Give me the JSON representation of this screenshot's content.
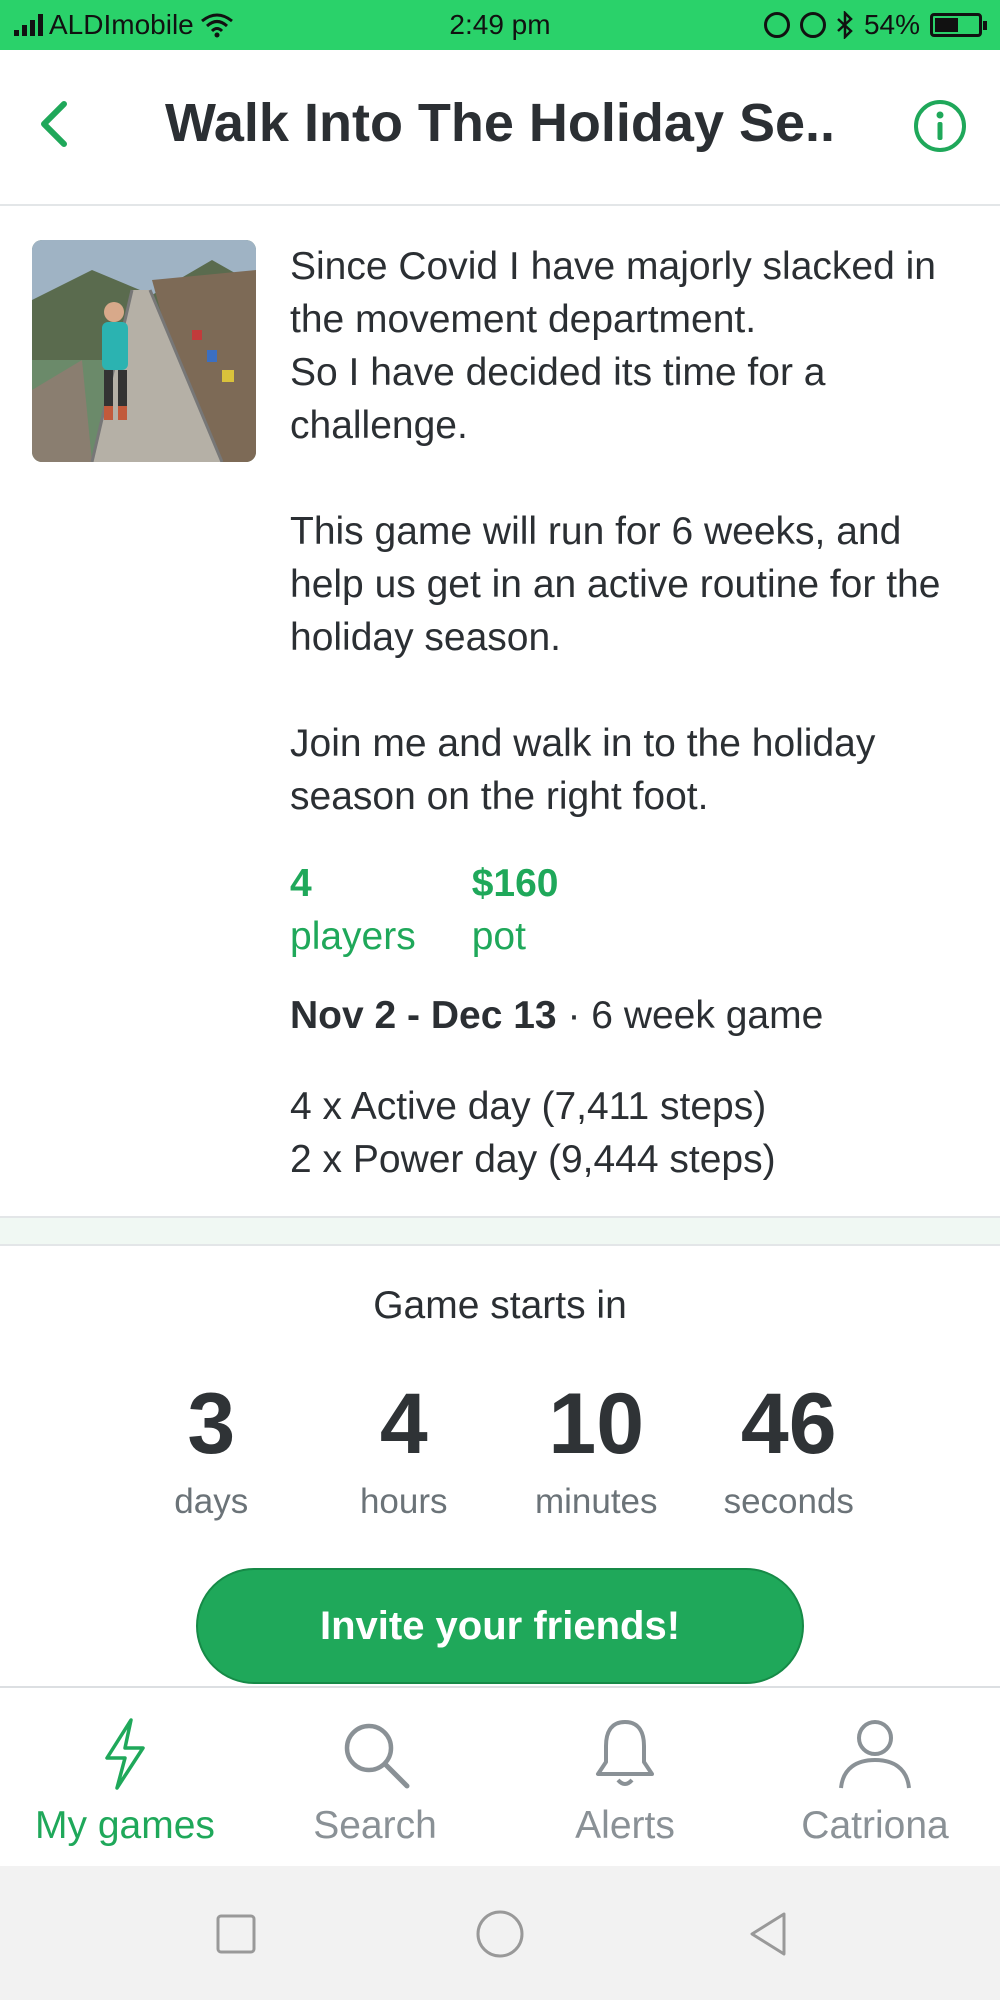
{
  "status_bar": {
    "carrier": "ALDImobile",
    "time": "2:49 pm",
    "battery": "54%",
    "battery_level": 0.54
  },
  "header": {
    "title": "Walk Into The Holiday Se..",
    "back_icon": "chevron-left-icon",
    "info_icon": "info-icon"
  },
  "description": {
    "paragraphs": [
      "Since Covid I have majorly slacked in the movement department.\nSo I have decided its time for a challenge.",
      "This game will run for 6 weeks, and help us get in an active routine for the holiday season.",
      "Join me and walk in to the holiday season on the right foot."
    ]
  },
  "stats": {
    "players_count": "4",
    "players_label": "players",
    "pot_value": "$160",
    "pot_label": "pot"
  },
  "schedule": {
    "dates": "Nov 2 - Dec 13",
    "duration": "· 6 week game"
  },
  "goals": [
    "4 x Active day (7,411 steps)",
    "2 x Power day (9,444 steps)"
  ],
  "countdown": {
    "title": "Game starts in",
    "units": [
      {
        "value": "3",
        "label": "days"
      },
      {
        "value": "4",
        "label": "hours"
      },
      {
        "value": "10",
        "label": "minutes"
      },
      {
        "value": "46",
        "label": "seconds"
      }
    ]
  },
  "invite_button": "Invite your friends!",
  "tabs": [
    {
      "label": "My games",
      "icon": "lightning-icon",
      "active": true
    },
    {
      "label": "Search",
      "icon": "search-icon",
      "active": false
    },
    {
      "label": "Alerts",
      "icon": "bell-icon",
      "active": false
    },
    {
      "label": "Catriona",
      "icon": "person-icon",
      "active": false
    }
  ],
  "colors": {
    "accent": "#1fa85a",
    "status_bar": "#2ad26a",
    "text": "#2b2f33",
    "muted": "#8a9196"
  }
}
